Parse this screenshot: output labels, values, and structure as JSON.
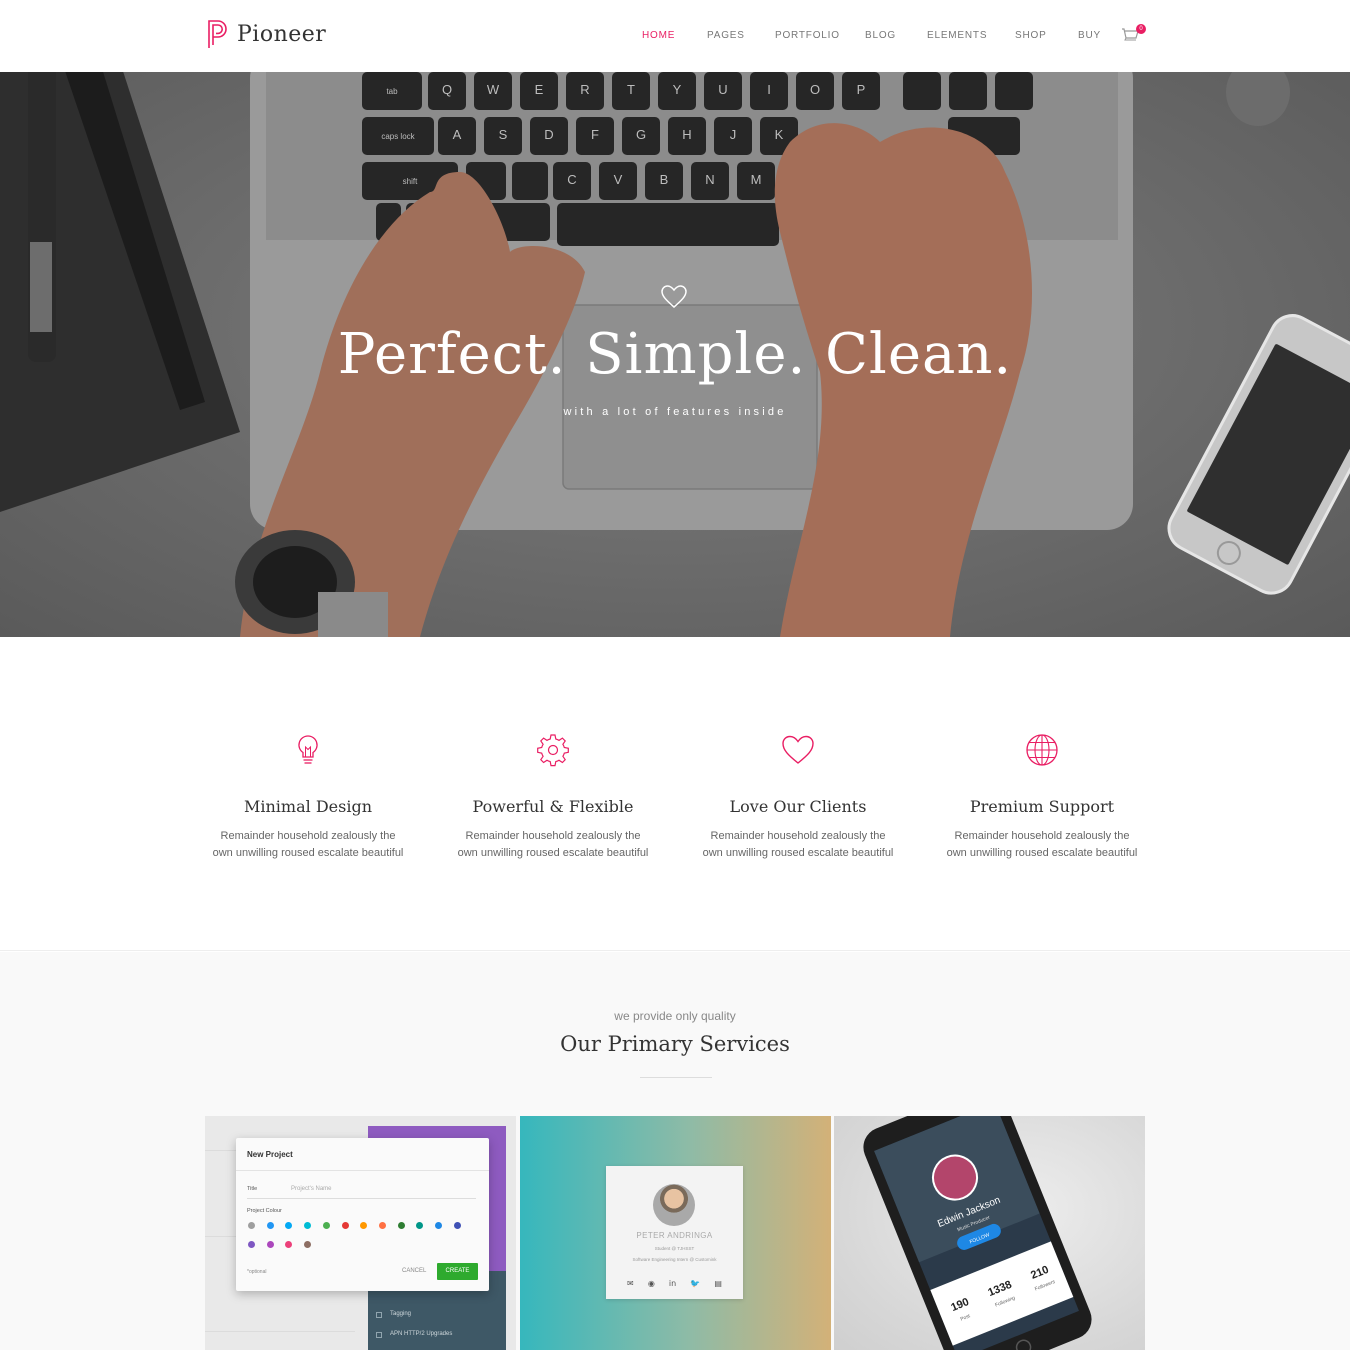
{
  "brand": {
    "name": "Pioneer",
    "accent": "#e91e63"
  },
  "nav": {
    "items": [
      {
        "label": "HOME",
        "active": true
      },
      {
        "label": "PAGES",
        "active": false
      },
      {
        "label": "PORTFOLIO",
        "active": false
      },
      {
        "label": "BLOG",
        "active": false
      },
      {
        "label": "ELEMENTS",
        "active": false
      },
      {
        "label": "SHOP",
        "active": false
      },
      {
        "label": "BUY",
        "active": false
      }
    ],
    "cart_count": "0"
  },
  "hero": {
    "icon": "heart-outline-icon",
    "title": "Perfect. Simple. Clean.",
    "subtitle": "with a lot of features inside",
    "keyboard_keys": [
      "Q",
      "W",
      "E",
      "R",
      "T",
      "Y",
      "U",
      "I",
      "O",
      "P",
      "A",
      "S",
      "D",
      "F",
      "G",
      "H",
      "J",
      "K",
      "C",
      "V",
      "B",
      "N",
      "M"
    ],
    "key_labels": {
      "tab": "tab",
      "caps": "caps lock",
      "shift": "shift"
    }
  },
  "features": [
    {
      "icon": "lightbulb-icon",
      "title": "Minimal Design",
      "text": "Remainder household zealously the own unwilling roused escalate beautiful"
    },
    {
      "icon": "gear-icon",
      "title": "Powerful & Flexible",
      "text": "Remainder household zealously the own unwilling roused escalate beautiful"
    },
    {
      "icon": "heart-icon",
      "title": "Love Our Clients",
      "text": "Remainder household zealously the own unwilling roused escalate beautiful"
    },
    {
      "icon": "globe-icon",
      "title": "Premium Support",
      "text": "Remainder household zealously the own unwilling roused escalate beautiful"
    }
  ],
  "services": {
    "eyebrow": "we provide only quality",
    "title": "Our Primary Services",
    "cards": [
      {
        "dialog_title": "New Project",
        "title_label": "Title",
        "title_placeholder": "Project's Name",
        "colour_label": "Project Colour",
        "swatches": [
          "#9e9e9e",
          "#2196f3",
          "#03a9f4",
          "#00bcd4",
          "#4caf50",
          "#e53935",
          "#ff9800",
          "#ff7043",
          "#2e7d32",
          "#009688",
          "#1e88e5",
          "#3f51b5",
          "#7e57c2",
          "#ab47bc",
          "#ec407a",
          "#8d6e63"
        ],
        "optional_note": "*optional",
        "cancel": "CANCEL",
        "create": "CREATE",
        "list_items": [
          "Tagging",
          "APN HTTP/2 Upgrades"
        ]
      },
      {
        "name": "PETER ANDRINGA",
        "line1": "Student @ TJHSST",
        "line2": "Software Engineering Intern @ Customink",
        "icons": [
          "mail-icon",
          "github-icon",
          "linkedin-icon",
          "twitter-icon",
          "document-icon"
        ],
        "icon_glyphs": [
          "✉",
          "◉",
          "in",
          "🐦",
          "▤"
        ]
      },
      {
        "profile_name": "Edwin Jackson",
        "role": "Music Producer",
        "follow": "FOLLOW",
        "stats": [
          {
            "value": "190",
            "label": "Post"
          },
          {
            "value": "1338",
            "label": "Following"
          },
          {
            "value": "210",
            "label": "Followers"
          }
        ]
      }
    ]
  }
}
